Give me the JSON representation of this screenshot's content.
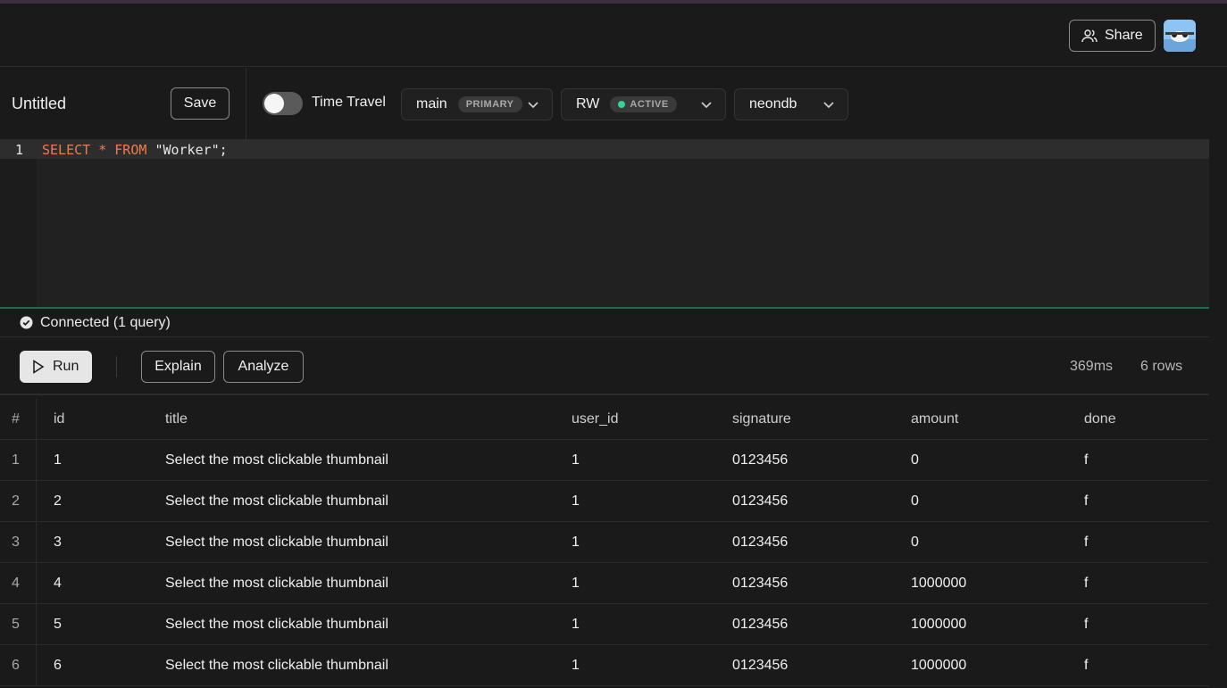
{
  "header": {
    "share_label": "Share"
  },
  "editor_toolbar": {
    "query_title": "Untitled",
    "save_label": "Save",
    "time_travel_label": "Time Travel",
    "branch": {
      "name": "main",
      "badge": "PRIMARY"
    },
    "compute": {
      "name": "RW",
      "badge": "ACTIVE",
      "status_color": "#34d399"
    },
    "database": {
      "name": "neondb"
    }
  },
  "editor": {
    "line_number": "1",
    "tokens": {
      "select": "SELECT",
      "star": "*",
      "from": "FROM",
      "table": "\"Worker\";"
    }
  },
  "status": {
    "text": "Connected (1 query)"
  },
  "actions": {
    "run_label": "Run",
    "explain_label": "Explain",
    "analyze_label": "Analyze",
    "duration": "369ms",
    "row_count": "6 rows"
  },
  "results": {
    "columns": [
      "#",
      "id",
      "title",
      "user_id",
      "signature",
      "amount",
      "done"
    ],
    "rows": [
      [
        "1",
        "1",
        "Select the most clickable thumbnail",
        "1",
        "0123456",
        "0",
        "f"
      ],
      [
        "2",
        "2",
        "Select the most clickable thumbnail",
        "1",
        "0123456",
        "0",
        "f"
      ],
      [
        "3",
        "3",
        "Select the most clickable thumbnail",
        "1",
        "0123456",
        "0",
        "f"
      ],
      [
        "4",
        "4",
        "Select the most clickable thumbnail",
        "1",
        "0123456",
        "1000000",
        "f"
      ],
      [
        "5",
        "5",
        "Select the most clickable thumbnail",
        "1",
        "0123456",
        "1000000",
        "f"
      ],
      [
        "6",
        "6",
        "Select the most clickable thumbnail",
        "1",
        "0123456",
        "1000000",
        "f"
      ]
    ]
  },
  "colors": {
    "accent_keyword": "#f07b4a",
    "active_green": "#34d399"
  }
}
